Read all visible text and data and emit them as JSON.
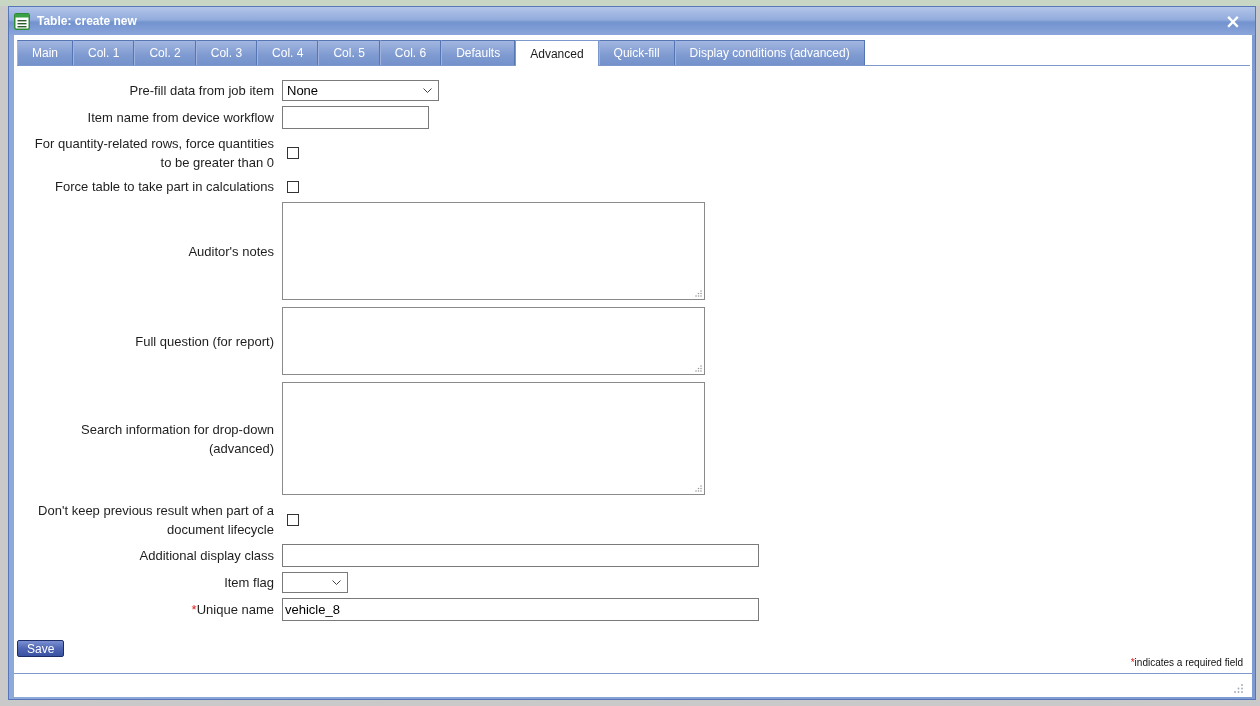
{
  "dialog": {
    "title": "Table: create new",
    "close": "×"
  },
  "tabs": [
    {
      "label": "Main",
      "selected": false
    },
    {
      "label": "Col. 1",
      "selected": false
    },
    {
      "label": "Col. 2",
      "selected": false
    },
    {
      "label": "Col. 3",
      "selected": false
    },
    {
      "label": "Col. 4",
      "selected": false
    },
    {
      "label": "Col. 5",
      "selected": false
    },
    {
      "label": "Col. 6",
      "selected": false
    },
    {
      "label": "Defaults",
      "selected": false
    },
    {
      "label": "Advanced",
      "selected": true
    },
    {
      "label": "Quick-fill",
      "selected": false
    },
    {
      "label": "Display conditions (advanced)",
      "selected": false
    }
  ],
  "fields": [
    {
      "kind": "select",
      "label": "Pre-fill data from job item",
      "value": "None"
    },
    {
      "kind": "text",
      "label": "Item name from device workflow"
    },
    {
      "kind": "checkbox",
      "label": "For quantity-related rows, force quantities to be greater than 0",
      "checked": false
    },
    {
      "kind": "checkbox",
      "label": "Force table to take part in calculations",
      "checked": false
    },
    {
      "kind": "textarea",
      "label": "Auditor's notes"
    },
    {
      "kind": "textarea",
      "label": "Full question (for report)"
    },
    {
      "kind": "textarea",
      "label": "Search information for drop-down (advanced)"
    },
    {
      "kind": "checkbox",
      "label": "Don't keep previous result when part of a document lifecycle",
      "checked": false
    },
    {
      "kind": "text",
      "label": "Additional display class"
    },
    {
      "kind": "select",
      "label": "Item flag"
    },
    {
      "kind": "text",
      "label": "Unique name",
      "required_mark": "*",
      "value": "vehicle_8"
    }
  ],
  "save_button": {
    "label": "Save"
  },
  "required_note": {
    "mark": "*",
    "text": "indicates a required field"
  }
}
